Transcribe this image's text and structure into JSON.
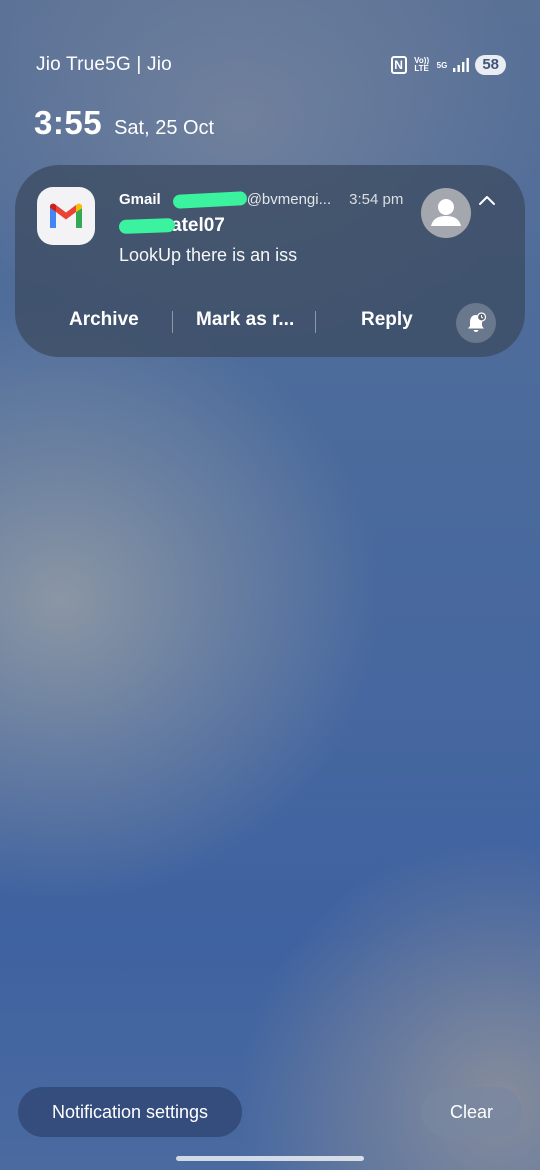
{
  "status_bar": {
    "carrier": "Jio True5G | Jio",
    "nfc_icon": "N",
    "volte_text": "Vo)) LTE",
    "net_text": "5G",
    "battery": "58"
  },
  "lock": {
    "time": "3:55",
    "date": "Sat, 25 Oct"
  },
  "notification": {
    "app": "Gmail",
    "account": "@bvmengi...",
    "time": "3:54 pm",
    "sender": "atel07",
    "preview": "LookUp there is an iss",
    "actions": {
      "archive": "Archive",
      "mark_read": "Mark as r...",
      "reply": "Reply"
    }
  },
  "bottom": {
    "settings": "Notification settings",
    "clear": "Clear"
  },
  "colors": {
    "redaction": "#3bf39e",
    "card_bg": "#3c4b62"
  }
}
